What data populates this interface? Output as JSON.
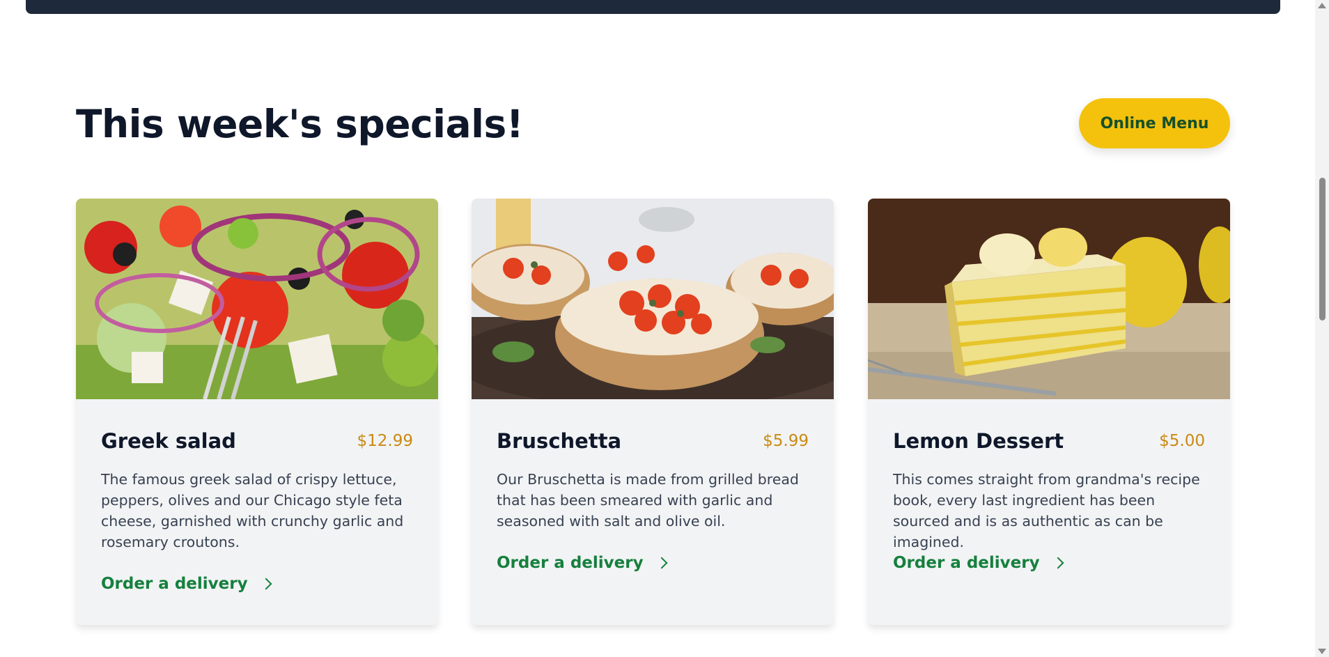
{
  "section": {
    "heading": "This week's specials!",
    "menu_button": "Online Menu"
  },
  "cards": [
    {
      "title": "Greek salad",
      "price": "$12.99",
      "description": "The famous greek salad of crispy lettuce, peppers, olives and our Chicago style feta cheese, garnished with crunchy garlic and rosemary croutons.",
      "link": "Order a delivery",
      "image_alt": "greek-salad-photo"
    },
    {
      "title": "Bruschetta",
      "price": "$5.99",
      "description": "Our Bruschetta is made from grilled bread that has been smeared with garlic and seasoned with salt and olive oil.",
      "link": "Order a delivery",
      "image_alt": "bruschetta-photo"
    },
    {
      "title": "Lemon Dessert",
      "price": "$5.00",
      "description": "This comes straight from grandma's recipe book, every last ingredient has been sourced and is as authentic as can be imagined.",
      "link": "Order a delivery",
      "image_alt": "lemon-dessert-photo"
    }
  ],
  "icons": {
    "link_chevron": "chevron-right-icon"
  },
  "colors": {
    "primary_yellow": "#f4c10c",
    "primary_green": "#15803d",
    "price_color": "#c98a12",
    "dark": "#1e293b"
  }
}
